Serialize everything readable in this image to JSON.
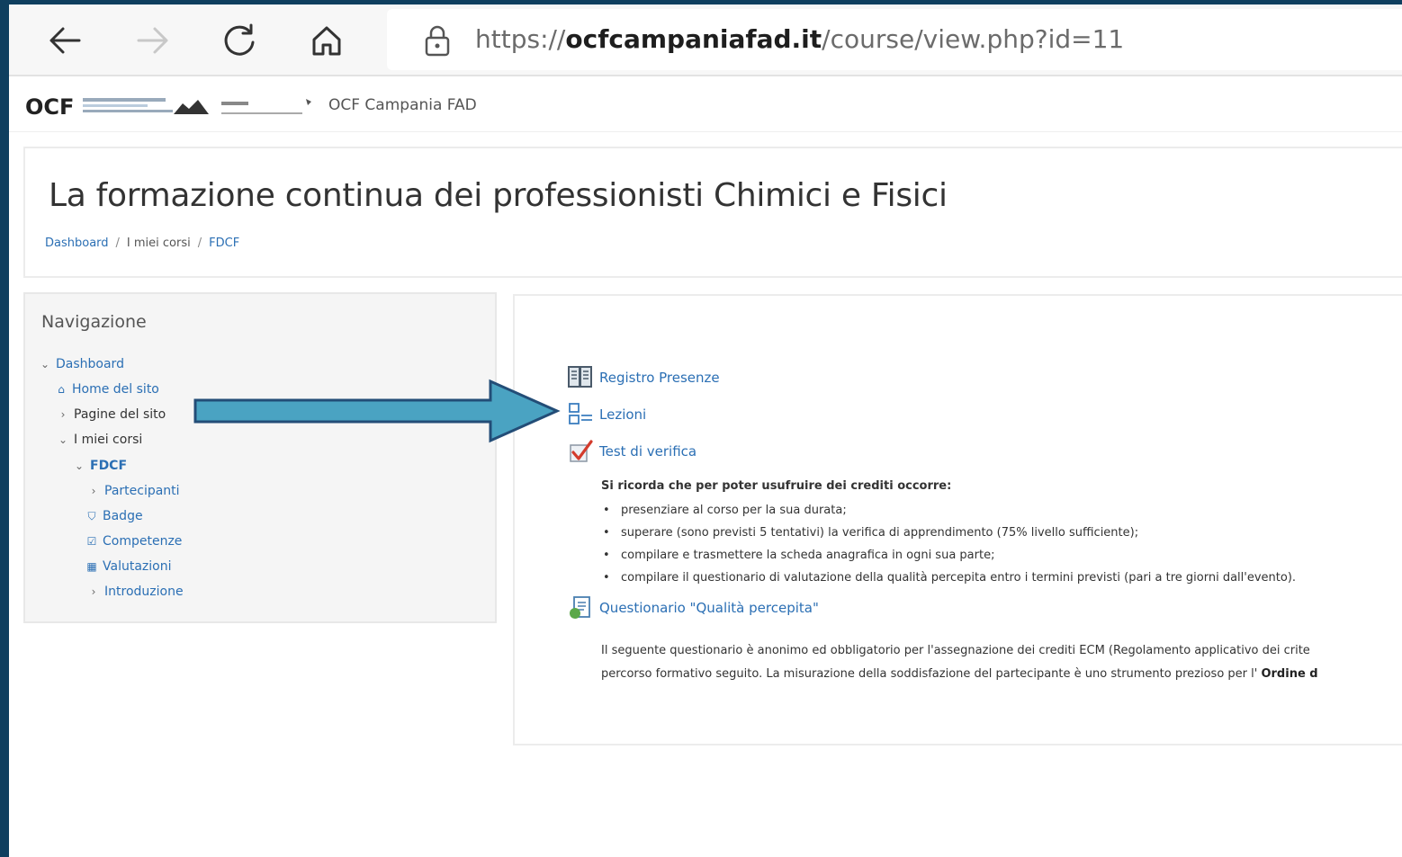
{
  "browser": {
    "url_prefix": "https://",
    "url_domain": "ocfcampaniafad.it",
    "url_path": "/course/view.php?id=11"
  },
  "site": {
    "logo_text": "OCF",
    "name": "OCF Campania FAD"
  },
  "page": {
    "title": "La formazione continua dei professionisti Chimici e Fisici",
    "breadcrumb": [
      "Dashboard",
      "I miei corsi",
      "FDCF"
    ]
  },
  "navigation": {
    "title": "Navigazione",
    "items": [
      {
        "label": "Dashboard",
        "glyph": "chevron-down-icon"
      },
      {
        "label": "Home del sito",
        "glyph": "home-icon"
      },
      {
        "label": "Pagine del sito",
        "glyph": "chevron-right-icon"
      },
      {
        "label": "I miei corsi",
        "glyph": "chevron-down-icon"
      },
      {
        "label": "FDCF",
        "glyph": "chevron-down-icon"
      },
      {
        "label": "Partecipanti",
        "glyph": "chevron-right-icon"
      },
      {
        "label": "Badge",
        "glyph": "shield-icon"
      },
      {
        "label": "Competenze",
        "glyph": "checkbox-icon"
      },
      {
        "label": "Valutazioni",
        "glyph": "table-icon"
      },
      {
        "label": "Introduzione",
        "glyph": "chevron-right-icon"
      }
    ]
  },
  "course": {
    "activities": [
      {
        "label": "Registro Presenze",
        "icon": "attendance-book-icon"
      },
      {
        "label": "Lezioni",
        "icon": "lesson-icon"
      },
      {
        "label": "Test di verifica",
        "icon": "quiz-check-icon"
      }
    ],
    "notice_heading": "Si ricorda che per poter usufruire dei crediti occorre:",
    "notice_items": [
      "presenziare al corso per la sua durata;",
      "superare (sono previsti 5 tentativi) la verifica di apprendimento (75% livello sufficiente);",
      "compilare e trasmettere la scheda anagrafica in ogni sua parte;",
      "compilare il questionario di valutazione della qualità percepita entro i termini previsti (pari a tre giorni dall'evento)."
    ],
    "questionnaire_label": "Questionario \"Qualità percepita\"",
    "questionnaire_desc_line1": "Il seguente questionario è anonimo ed obbligatorio per l'assegnazione dei crediti ECM (Regolamento applicativo dei crite",
    "questionnaire_desc_line2": "percorso formativo seguito. La misurazione della soddisfazione del partecipante è uno strumento prezioso per l'",
    "questionnaire_desc_bold": "Ordine d"
  },
  "colors": {
    "link": "#2b6fb4",
    "arrow_fill": "#4aa3c2",
    "arrow_stroke": "#234d77",
    "frame": "#0f3f5f"
  }
}
